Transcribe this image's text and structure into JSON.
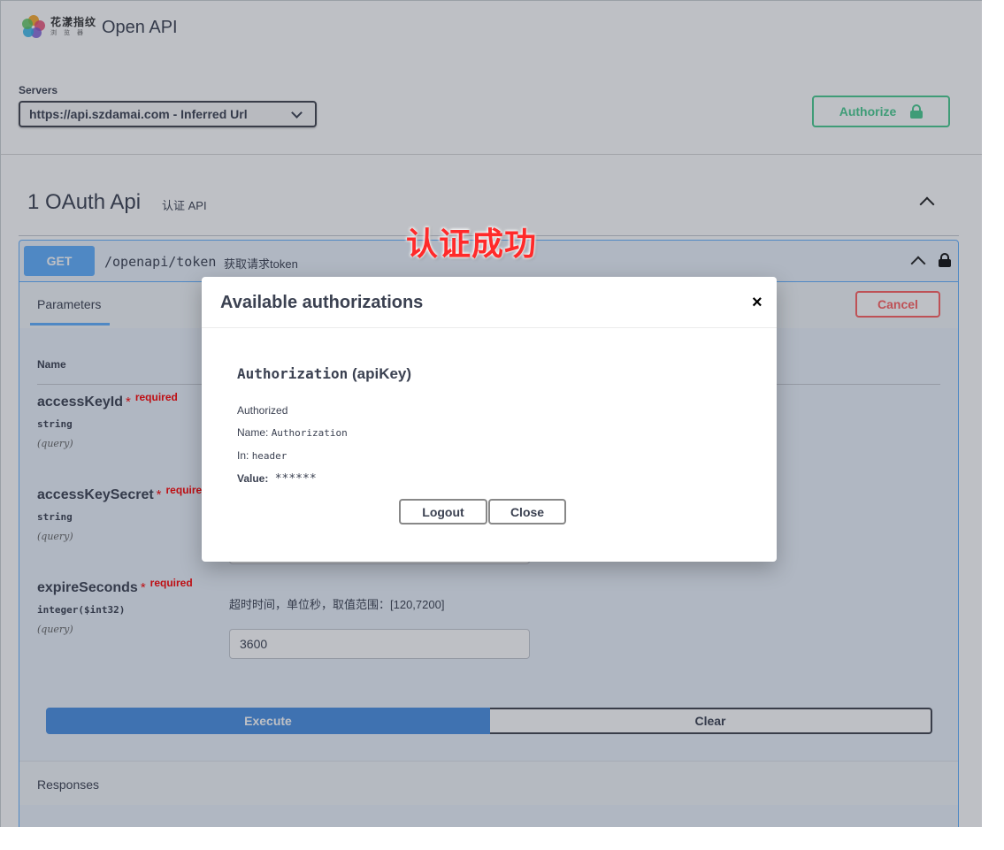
{
  "header": {
    "logo_text": "花漾指纹",
    "logo_subtext": "浏览器",
    "title": "Open API"
  },
  "servers": {
    "label": "Servers",
    "selected": "https://api.szdamai.com - Inferred Url"
  },
  "authorize": {
    "label": "Authorize"
  },
  "section": {
    "title": "1 OAuth Api",
    "subtitle": "认证 API"
  },
  "operation": {
    "method": "GET",
    "path": "/openapi/token",
    "summary": "获取请求token",
    "tab_label": "Parameters",
    "cancel_label": "Cancel",
    "name_header": "Name",
    "params": [
      {
        "name": "accessKeyId",
        "star": "*",
        "required": "required",
        "type": "string",
        "in": "(query)"
      },
      {
        "name": "accessKeySecret",
        "star": "*",
        "required": "required",
        "type": "string",
        "in": "(query)"
      },
      {
        "name": "expireSeconds",
        "star": "*",
        "required": "required",
        "type": "integer($int32)",
        "in": "(query)",
        "description": "超时时间，单位秒，取值范围：[120,7200]",
        "value": "3600"
      }
    ],
    "execute_label": "Execute",
    "clear_label": "Clear",
    "responses_label": "Responses"
  },
  "annotation": {
    "text": "认证成功"
  },
  "modal": {
    "title": "Available authorizations",
    "close": "×",
    "scheme_name": "Authorization",
    "scheme_type": "(apiKey)",
    "status": "Authorized",
    "name_label": "Name:",
    "name_value": "Authorization",
    "in_label": "In:",
    "in_value": "header",
    "value_label": "Value:",
    "value_value": "******",
    "logout_label": "Logout",
    "close_label": "Close"
  },
  "colors": {
    "get": "#61affe",
    "authorize": "#49cc90",
    "cancel": "#ff6060",
    "required": "#ff0000",
    "annotation": "#ff2a2a"
  }
}
